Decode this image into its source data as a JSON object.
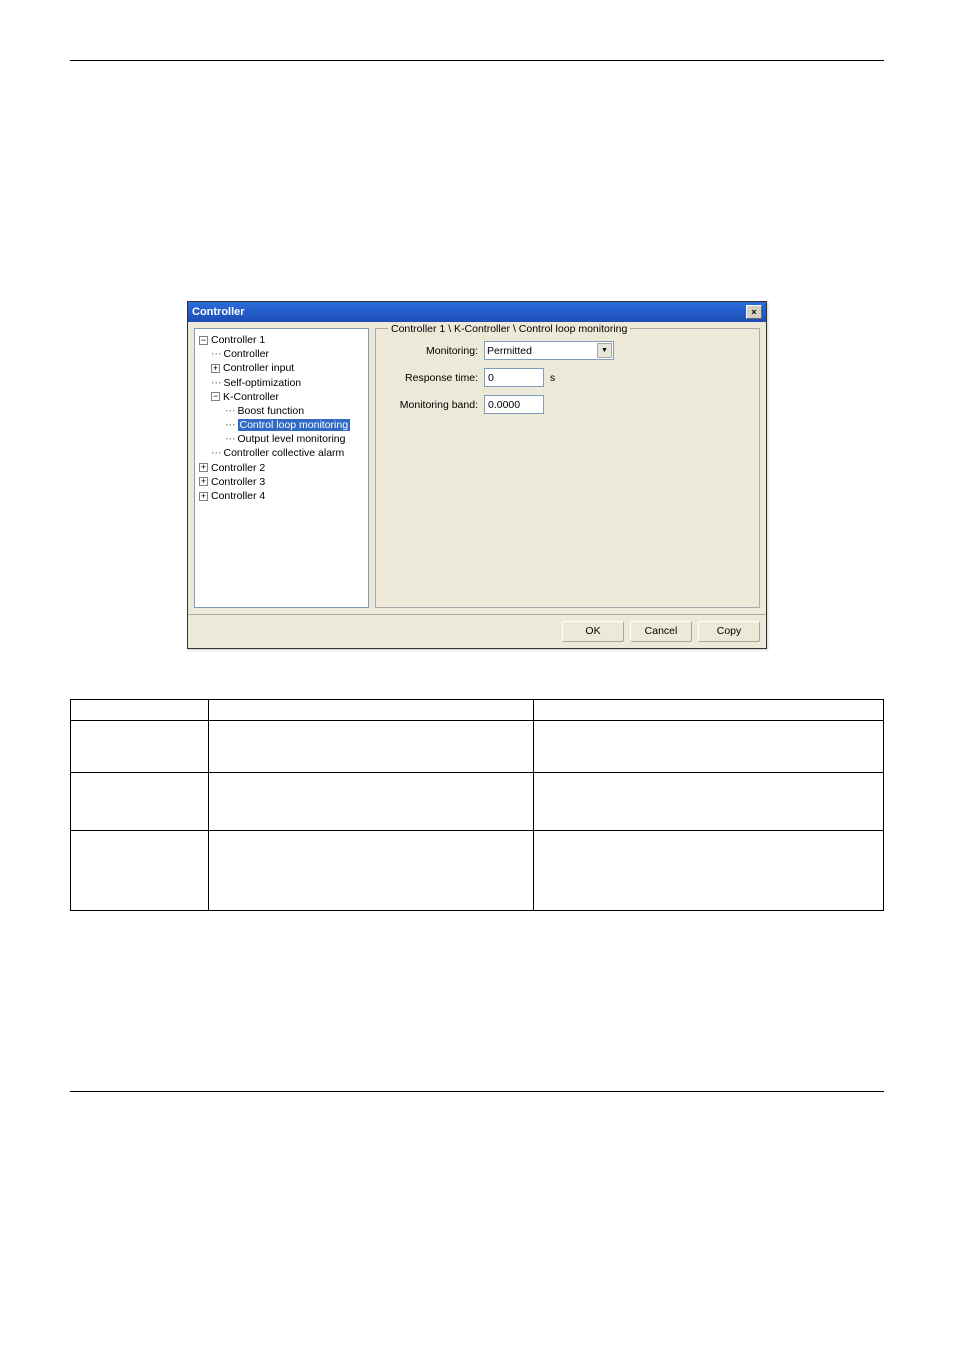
{
  "dialog": {
    "title": "Controller",
    "close_icon": "×"
  },
  "tree": {
    "n1": "Controller 1",
    "n1_1": "Controller",
    "n1_2": "Controller input",
    "n1_3": "Self-optimization",
    "n1_4": "K-Controller",
    "n1_4_1": "Boost function",
    "n1_4_2": "Control loop monitoring",
    "n1_4_3": "Output level monitoring",
    "n1_5": "Controller collective alarm",
    "n2": "Controller 2",
    "n3": "Controller 3",
    "n4": "Controller 4"
  },
  "form": {
    "legend": "Controller 1 \\ K-Controller \\ Control loop monitoring",
    "monitoring_label": "Monitoring:",
    "monitoring_value": "Permitted",
    "response_label": "Response time:",
    "response_value": "0",
    "response_unit": "s",
    "band_label": "Monitoring band:",
    "band_value": "0.0000"
  },
  "buttons": {
    "ok": "OK",
    "cancel": "Cancel",
    "copy": "Copy"
  },
  "table": {
    "h1": "",
    "h2": "",
    "h3": ""
  }
}
